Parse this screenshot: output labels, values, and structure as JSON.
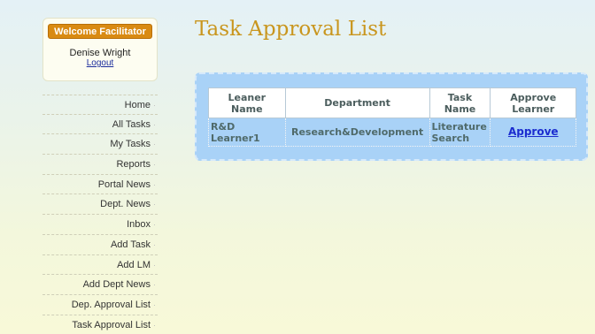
{
  "welcome": {
    "badge": "Welcome Facilitator",
    "user_name": "Denise Wright",
    "logout": "Logout"
  },
  "sidebar": {
    "items": [
      {
        "label": "Home"
      },
      {
        "label": "All Tasks"
      },
      {
        "label": "My Tasks"
      },
      {
        "label": "Reports"
      },
      {
        "label": "Portal News"
      },
      {
        "label": "Dept. News"
      },
      {
        "label": "Inbox"
      },
      {
        "label": "Add Task"
      },
      {
        "label": "Add LM"
      },
      {
        "label": "Add Dept News"
      },
      {
        "label": "Dep. Approval List"
      },
      {
        "label": "Task Approval List"
      }
    ]
  },
  "page": {
    "title": "Task Approval List"
  },
  "table": {
    "headers": {
      "learner_line1": "Leaner",
      "learner_line2": "Name",
      "department": "Department",
      "task_line1": "Task",
      "task_line2": "Name",
      "approve_line1": "Approve",
      "approve_line2": "Learner"
    },
    "rows": [
      {
        "learner_line1": "R&D",
        "learner_line2": "Learner1",
        "department": "Research&Development",
        "task_line1": "Literature",
        "task_line2": "Search",
        "action": "Approve"
      }
    ]
  }
}
